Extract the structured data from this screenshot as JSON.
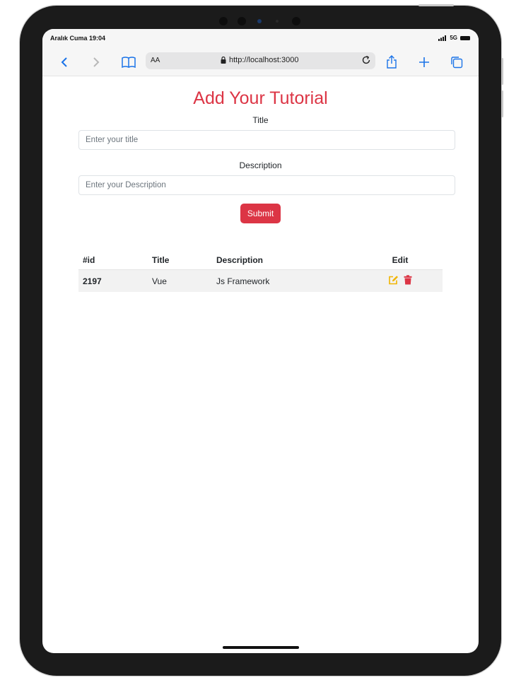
{
  "status": {
    "time": "Aralık Cuma 19:04",
    "network": "5G"
  },
  "browser": {
    "aa_label": "AA",
    "url": "http://localhost:3000"
  },
  "form": {
    "heading": "Add Your Tutorial",
    "title_label": "Title",
    "title_placeholder": "Enter your title",
    "title_value": "",
    "description_label": "Description",
    "description_placeholder": "Enter your Description",
    "description_value": "",
    "submit_label": "Submit"
  },
  "table": {
    "headers": [
      "#id",
      "Title",
      "Description",
      "Edit"
    ],
    "rows": [
      {
        "id": "2197",
        "title": "Vue",
        "description": "Js Framework"
      }
    ]
  },
  "colors": {
    "accent": "#dc3545",
    "edit_icon": "#f0b400",
    "link_blue": "#1a73e8"
  },
  "icons": [
    "back-icon",
    "forward-icon",
    "bookmarks-icon",
    "lock-icon",
    "reload-icon",
    "share-icon",
    "add-tab-icon",
    "tabs-icon",
    "edit-icon",
    "trash-icon"
  ]
}
